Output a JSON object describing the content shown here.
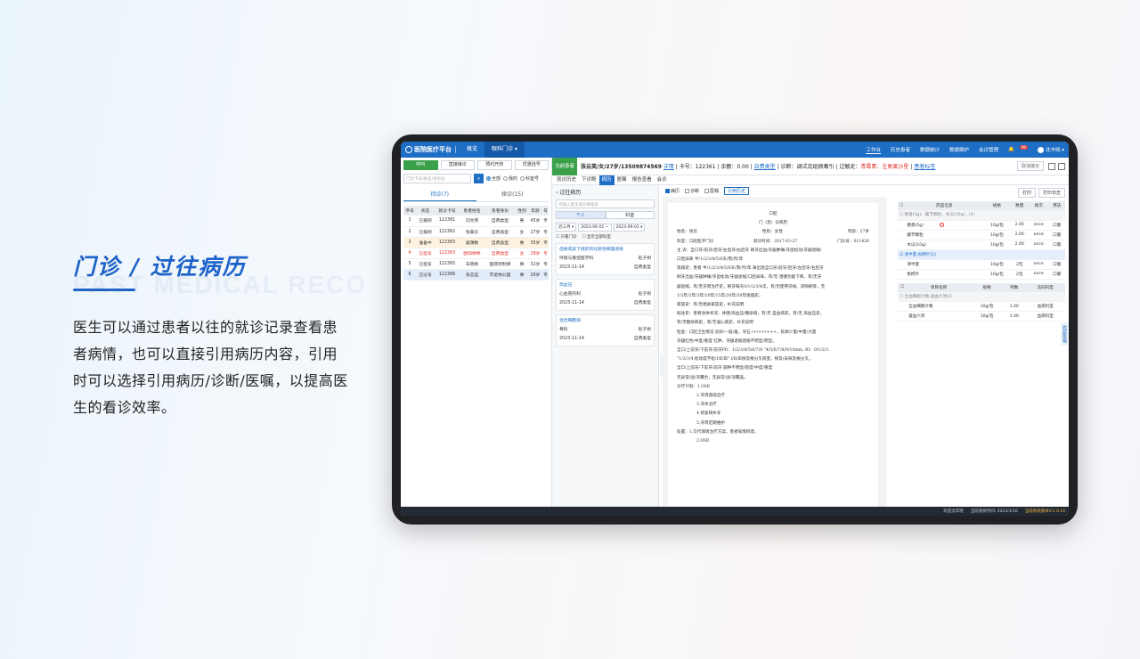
{
  "caption": {
    "bg_word": "PAST MEDICAL RECO",
    "title": "门诊 / 过往病历",
    "body": "医生可以通过患者以往的就诊记录查看患者病情，也可以直接引用病历内容，引用时可以选择引用病历/诊断/医嘱，以提高医生的看诊效率。"
  },
  "topbar": {
    "logo": "医院医疗平台",
    "tabs": [
      "概览",
      "眼科门诊 ▾"
    ],
    "right_items": [
      "工作台",
      "历史患者",
      "数据统计",
      "数据维护",
      "会诊管理"
    ],
    "badge": "99",
    "user": "沈丰晓 ▾"
  },
  "left": {
    "buttons": [
      "呼叫",
      "直接接诊",
      "预约开药",
      "优惠挂号"
    ],
    "search_placeholder": "门诊卡号/姓名/身份证",
    "radios": [
      "全部",
      "我的",
      "科室号"
    ],
    "tabs": [
      "待诊(7)",
      "续诊(15)"
    ],
    "columns": [
      "序号",
      "状态",
      "就诊卡号",
      "患者姓名",
      "患者身份",
      "性别",
      "年龄",
      "号"
    ],
    "rows": [
      [
        "1",
        "已报到",
        "122361",
        "刘文燕",
        "自费类型",
        "男",
        "45岁",
        "专"
      ],
      [
        "2",
        "已报到",
        "122362",
        "张美云",
        "自费类型",
        "女",
        "27岁",
        "专"
      ],
      [
        "3",
        "准备中",
        "122363",
        "吴瑞敏",
        "自费类型",
        "男",
        "35岁",
        "专"
      ],
      [
        "4",
        "已挂号",
        "122363",
        "欧阳婷婷",
        "自费类型",
        "女",
        "28岁",
        "专"
      ],
      [
        "5",
        "已挂号",
        "122365",
        "车晓桦",
        "医院领制保",
        "男",
        "32岁",
        "专"
      ],
      [
        "6",
        "已过号",
        "122366",
        "张志远",
        "市退休公医",
        "男",
        "26岁",
        "专"
      ]
    ]
  },
  "patient": {
    "current": "当前患者",
    "info": "张云英/女/27岁/13509874569",
    "detail": "详情",
    "card": "卡号：122361",
    "amount": "余额：0.00",
    "type": "自费类型",
    "diag": "诊断：调试克组病毒引",
    "allergy_label": "过敏史：",
    "allergy": "青霉素、左氧氟沙星",
    "record": "患者标签",
    "cancel": "取消接诊"
  },
  "subtabs": [
    "就诊历史",
    "下诊断",
    "病历",
    "医嘱",
    "报告查看",
    "会诊"
  ],
  "history": {
    "title": "过往病历",
    "search_placeholder": "可输入医生或诊断搜索",
    "tabs": [
      "个人",
      "科室"
    ],
    "filters": [
      "近三月 ▾",
      "2023-06-01 ~",
      "2023-09-01 ▾"
    ],
    "checks": [
      "只看门诊",
      "显示全部科室"
    ],
    "cards": [
      {
        "title": "齿根或皮下组织的化脓性细菌感染",
        "dept": "呼吸与重症医学科",
        "doctor": "赵子树",
        "date": "2023-11-14",
        "type": "自费类型"
      },
      {
        "title": "高血压",
        "dept": "心血管内科",
        "doctor": "赵子树",
        "date": "2023-11-14",
        "type": "自费类型"
      },
      {
        "title": "混合细胞病",
        "dept": "骨科",
        "doctor": "赵子树",
        "date": "2023-11-14",
        "type": "自费类型"
      }
    ],
    "collapse": "收起病历"
  },
  "doc": {
    "toolbar": [
      "病历",
      "诊断",
      "医嘱",
      "引用历史"
    ],
    "hospital": "口腔",
    "title": "门（急）诊病历",
    "name": "姓名：张云",
    "sex": "性别：女性",
    "age": "年龄：27岁",
    "dept": "科室：口腔医学门诊",
    "date": "就诊时间：2017-03-27",
    "no": "门诊号：011426",
    "lines": [
      "主 诉：全口牙/前牙/后牙/左后牙/右后牙 刷牙出血/牙龈肿痛/牙齿松动/牙龈退缩/",
      "口腔异味 半/1/2/3/4/5/6天/周/月/年",
      "现病史：患者 半/1/2/3/4/5/6天/周/月/年 来出现全口牙/前牙/后牙/左后牙/右后牙",
      "刷牙出血/牙龈肿痛/牙齿松动/牙龈退缩/口腔异味，有/无 咀嚼功能下降，有/无牙",
      "龈退缩，有/无牙周治疗史，刷牙每天0/1/2/3/4次，有/无使用牙线、间隙刷等，无",
      "1/2年/2年/3年/10年/15年/20年/30年吸烟史。",
      "家族史：有/无相关家族史，补充说明",
      "既往史：患者身体状况：体健/高血压/糖尿病，有/无 自血病史，有/无 高血压史，",
      "有/无糖尿病史，有/无凝心病史，补充说明",
      "检查：口腔卫生情况 良好/一般/差，牙石-/+/++/+++，软垢少量/中量/大量",
      "牙龈红色/中度/重度 红肿，牙龈退缩退缩不明显/明显，",
      "全口/上前牙/下前牙/前牙PD：1/2/3/4/5/6/7/8 \"4/5/6/7/8/9/10mm, BI：0/1/2/3",
      "\"1/2/3/4.松动度不松/Ⅰ/Ⅱ/Ⅲ\" Ⅰ/Ⅱ/Ⅲ探及根分叉病变，探及/未探及根分叉，",
      "全口/上前牙/下前牙/前牙 圆钟不明显/轻度/中度/重度",
      "无异常/战/深覆合，无异常/战/深覆盖。",
      "诊疗计划：1.OHI",
      "2.牙周基础治疗",
      "3.牙体治疗",
      "4.修复缺失牙",
      "5.牙周定期维护",
      "处置：1.交代病情治疗方案，患者知情同意。",
      "2.OHI"
    ]
  },
  "drug": {
    "buttons": [
      "打印",
      "打印日志"
    ],
    "columns": [
      "药品信息",
      "规格",
      "数量",
      "频次",
      "用法"
    ],
    "group1": "根香(5g)、藕节颗粒、木瓜(10g)...(3)",
    "rows1": [
      [
        "檀香(5g)",
        "10g/包",
        "2.00",
        "once",
        "口服"
      ],
      [
        "藕节颗粒",
        "10g/包",
        "2.00",
        "once",
        "口服"
      ],
      [
        "木瓜(10g)",
        "10g/包",
        "2.00",
        "once",
        "口服"
      ]
    ],
    "group2": "清半夏,枇杷叶(2)",
    "rows2": [
      [
        "清半夏",
        "10g/包",
        "2包",
        "once",
        "口服"
      ],
      [
        "枇杷叶",
        "10g/包",
        "2包",
        "once",
        "口服"
      ]
    ],
    "columns2": [
      "项目名称",
      "规格",
      "例数",
      "流向科室"
    ],
    "group3": "全血细胞计数,凝血六项(2)",
    "rows3": [
      [
        "全血细胞计数",
        "10g/包",
        "1.00",
        "血液科室"
      ],
      [
        "凝血六项",
        "10g/包",
        "1.00",
        "血液科室"
      ]
    ],
    "side": "收起医嘱"
  },
  "footer": {
    "welcome": "欢迎沈丰晓",
    "time": "当前系统时间: 2023/3/16",
    "version": "当前系统版本V.1.0.14"
  }
}
